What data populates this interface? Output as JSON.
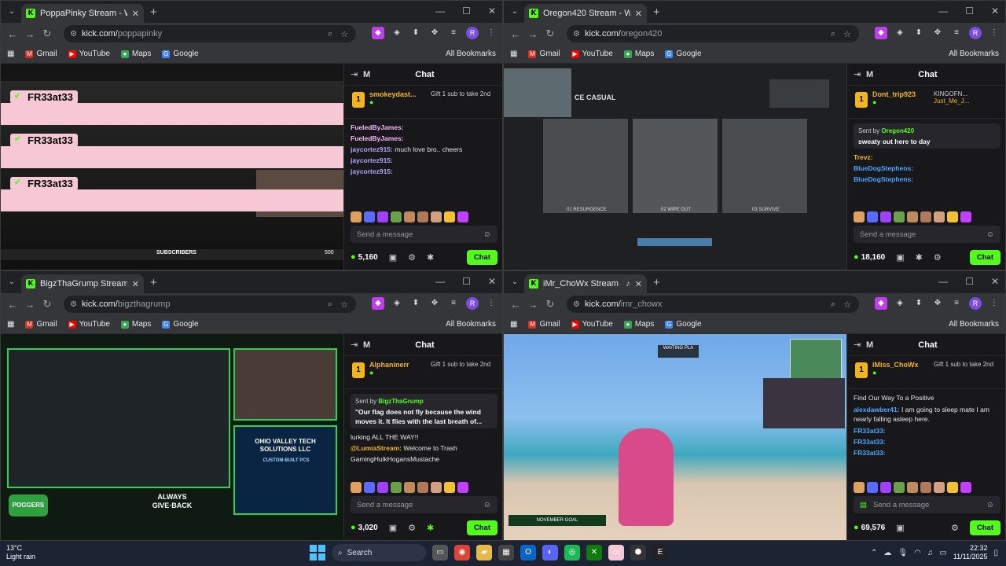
{
  "browser": {
    "bookmarks": [
      "Gmail",
      "YouTube",
      "Maps",
      "Google"
    ],
    "all_bookmarks": "All Bookmarks",
    "profile_initial": "R"
  },
  "windows": [
    {
      "tab_title": "PoppaPinky Stream - Watch Live",
      "url_host": "kick.com/",
      "url_path": "poppapinky",
      "chat_title": "Chat",
      "pinned_user": "smokeydast...",
      "pinned_extra": "",
      "gift_text": "Gift 1 sub to take 2nd",
      "overlay_tags": [
        "FR33at33",
        "FR33at33",
        "FR33at33"
      ],
      "messages": [
        {
          "user": "FueledByJames:",
          "text": "",
          "color": "#f9b7ff"
        },
        {
          "user": "FueledByJames:",
          "text": "",
          "color": "#f9b7ff"
        },
        {
          "user": "jaycortez915:",
          "text": " much love bro.. cheers",
          "color": "#b6a4ff"
        },
        {
          "user": "jaycortez915:",
          "text": "",
          "color": "#b6a4ff"
        },
        {
          "user": "jaycortez915:",
          "text": "",
          "color": "#b6a4ff"
        }
      ],
      "video_labels": [
        "SUBSCRIBERS",
        "500"
      ],
      "viewers": "5,160",
      "send_placeholder": "Send a message",
      "chat_button": "Chat"
    },
    {
      "tab_title": "Oregon420 Stream - Watch Live",
      "url_host": "kick.com/",
      "url_path": "oregon420",
      "chat_title": "Chat",
      "pinned_user": "Dont_trip923",
      "pinned_extra": "KINGOFN...",
      "gift_text": "Just_Me_J...",
      "pin_by": "Oregon420",
      "pin_text": "sweaty out here to day",
      "messages": [
        {
          "user": "Trevz:",
          "text": "",
          "color": "#f2b51d"
        },
        {
          "user": "BlueDogStephens:",
          "text": "",
          "color": "#4aa8ff"
        },
        {
          "user": "BlueDogStephens:",
          "text": "",
          "color": "#4aa8ff"
        }
      ],
      "video_labels": [
        "CE CASUAL",
        "01 RESURGENCE",
        "02 WIPE OUT",
        "03 SURVIVE"
      ],
      "viewers": "18,160",
      "send_placeholder": "Send a message",
      "chat_button": "Chat"
    },
    {
      "tab_title": "BigzThaGrump Stream - Watch",
      "url_host": "kick.com/",
      "url_path": "bigzthagrump",
      "chat_title": "Chat",
      "pinned_user": "Alphaninerr",
      "pinned_extra": "",
      "gift_text": "Gift 1 sub to take 2nd",
      "pin_by": "BigzThaGrump",
      "pin_text": "\"Our flag does not fly because the wind moves it. It flies with the last breath of...",
      "messages": [
        {
          "user": "",
          "text": "lurking ALL THE WAY!!",
          "color": "#e8e8e8"
        },
        {
          "user": "@LumiaStream:",
          "text": " Welcome to Trash GamingHulkHogansMustache",
          "color": "#f2b51d"
        }
      ],
      "video_labels": [
        "POGGERS",
        "ALWAYS GIVE·BACK",
        "OHIO VALLEY TECH SOLUTIONS LLC",
        "CUSTOM-BUILT PCS"
      ],
      "viewers": "3,020",
      "send_placeholder": "Send a message",
      "chat_button": "Chat"
    },
    {
      "tab_title": "iMr_ChoWx Stream - Watch",
      "url_host": "kick.com/",
      "url_path": "imr_chowx",
      "chat_title": "Chat",
      "pinned_user": "iMiss_ChoWx",
      "pinned_extra": "",
      "gift_text": "Gift 1 sub to take 2nd",
      "messages": [
        {
          "user": "",
          "text": "Find Our Way To a Positive",
          "color": "#e8e8e8"
        },
        {
          "user": "alexdawber41:",
          "text": " I am going to sleep mate I am nearly falling asleep here.",
          "color": "#4aa8ff"
        },
        {
          "user": "FR33at33:",
          "text": "",
          "color": "#4aa8ff"
        },
        {
          "user": "FR33at33:",
          "text": "",
          "color": "#4aa8ff"
        },
        {
          "user": "FR33at33:",
          "text": "",
          "color": "#4aa8ff"
        }
      ],
      "video_labels": [
        "WAITING PLA",
        "NOVEMBER GOAL"
      ],
      "viewers": "69,576",
      "send_placeholder": "Send a message",
      "chat_button": "Chat"
    }
  ],
  "taskbar": {
    "temp": "13°C",
    "weather": "Light rain",
    "search": "Search",
    "time": "22:32",
    "date": "11/11/2025"
  },
  "colors": {
    "kick_green": "#53fc18",
    "chat_bg": "#18181b",
    "browser_frame": "#35363a",
    "overlay_pink": "#f6c8d6"
  }
}
